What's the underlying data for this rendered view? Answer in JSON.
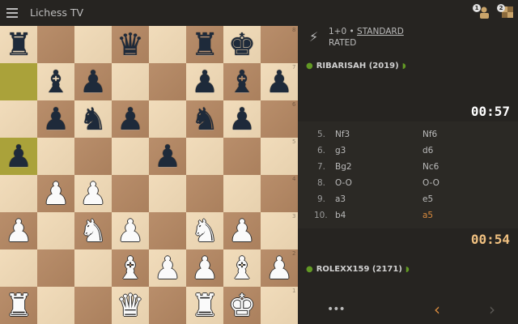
{
  "header": {
    "title": "Lichess TV",
    "menu_icon": "hamburger-icon",
    "challenge_badge": "1",
    "notification_badge": "2"
  },
  "board": {
    "ranks": [
      "8",
      "7",
      "6",
      "5",
      "4",
      "3",
      "2",
      "1"
    ],
    "files": [
      "a",
      "b",
      "c",
      "d",
      "e",
      "f",
      "g",
      "h"
    ],
    "last_move_squares": [
      "a7",
      "a5"
    ],
    "position": [
      [
        "bR",
        "",
        "",
        "bQ",
        "",
        "bR",
        "bK",
        ""
      ],
      [
        "",
        "bB",
        "bP",
        "",
        "",
        "bP",
        "bB",
        "bP"
      ],
      [
        "",
        "bP",
        "bN",
        "bP",
        "",
        "bN",
        "bP",
        ""
      ],
      [
        "bP",
        "",
        "",
        "",
        "bP",
        "",
        "",
        ""
      ],
      [
        "",
        "wP",
        "wP",
        "",
        "",
        "",
        "",
        ""
      ],
      [
        "wP",
        "",
        "wN",
        "wP",
        "",
        "wN",
        "wP",
        ""
      ],
      [
        "",
        "",
        "",
        "wB",
        "wP",
        "wP",
        "wB",
        "wP"
      ],
      [
        "wR",
        "",
        "",
        "wQ",
        "",
        "wR",
        "wK",
        ""
      ]
    ]
  },
  "game": {
    "time_control": "1+0 • ",
    "variant": "STANDARD",
    "rated": "RATED"
  },
  "players": {
    "top": {
      "name": "RIBARISAH (2019)",
      "clock": "00:57"
    },
    "bottom": {
      "name": "ROLEXX159 (2171)",
      "clock": "00:54"
    }
  },
  "moves": [
    {
      "num": "5.",
      "white": "Nf3",
      "black": "Nf6"
    },
    {
      "num": "6.",
      "white": "g3",
      "black": "d6"
    },
    {
      "num": "7.",
      "white": "Bg2",
      "black": "Nc6"
    },
    {
      "num": "8.",
      "white": "O-O",
      "black": "O-O"
    },
    {
      "num": "9.",
      "white": "a3",
      "black": "e5"
    },
    {
      "num": "10.",
      "white": "b4",
      "black": "a5"
    }
  ],
  "controls": {
    "more": "•••",
    "prev": "‹",
    "next": "›"
  }
}
